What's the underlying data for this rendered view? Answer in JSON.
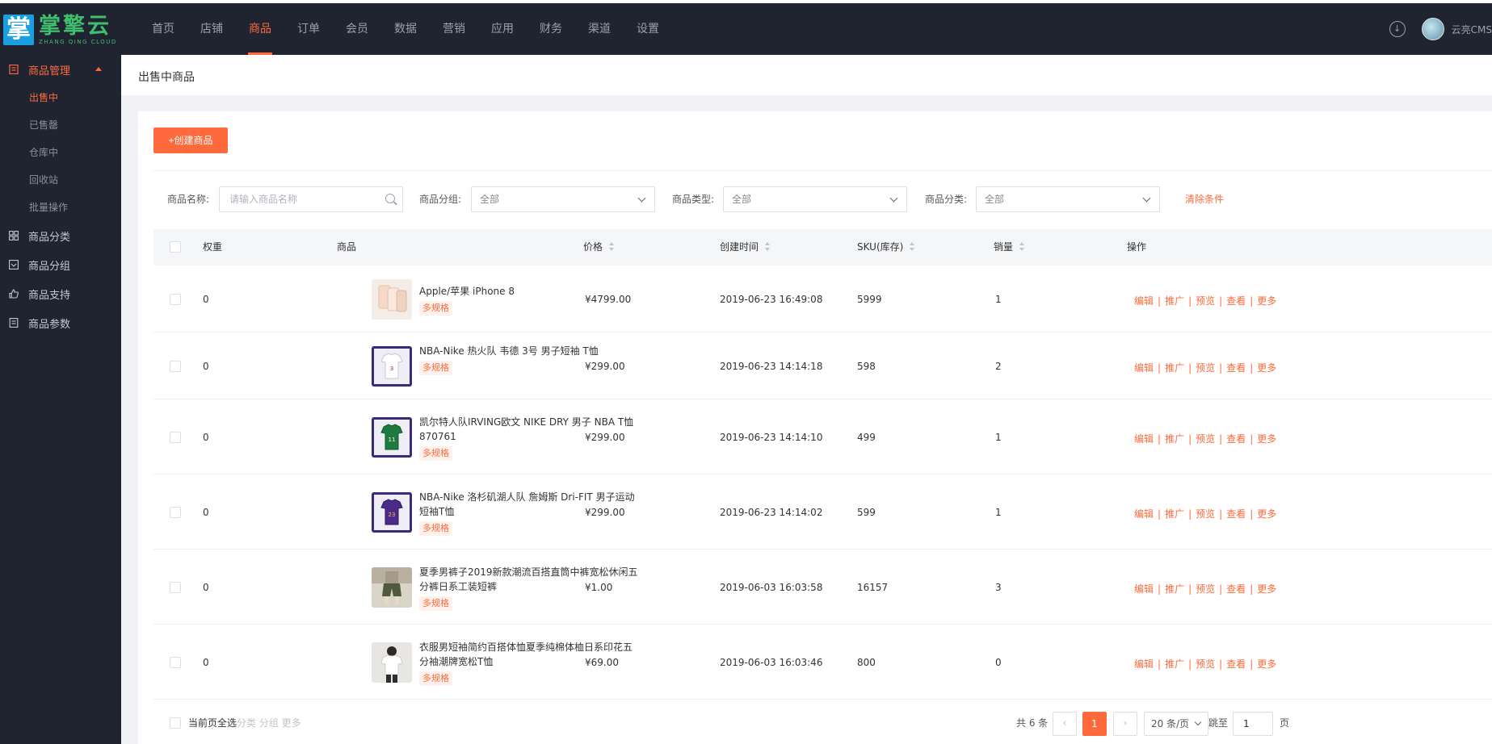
{
  "app": {
    "logo_glyph": "掌",
    "logo_name": "掌擎云",
    "logo_en": "ZHANG QING CLOUD",
    "user_name": "云亮CMS",
    "accent": "#ff6a3c"
  },
  "nav": [
    "首页",
    "店铺",
    "商品",
    "订单",
    "会员",
    "数据",
    "营销",
    "应用",
    "财务",
    "渠道",
    "设置"
  ],
  "sidebar": {
    "group_main": "商品管理",
    "sub_items": [
      "出售中",
      "已售罄",
      "仓库中",
      "回收站",
      "批量操作"
    ],
    "groups": [
      "商品分类",
      "商品分组",
      "商品支持",
      "商品参数"
    ]
  },
  "page": {
    "title": "出售中商品",
    "create_label": "+创建商品"
  },
  "filters": {
    "name_label": "商品名称:",
    "name_placeholder": "请输入商品名称",
    "group_label": "商品分组:",
    "group_value": "全部",
    "type_label": "商品类型:",
    "type_value": "全部",
    "category_label": "商品分类:",
    "category_value": "全部",
    "clear_label": "清除条件"
  },
  "table": {
    "headers": {
      "weight": "权重",
      "product": "商品",
      "price": "价格",
      "created": "创建时间",
      "sku": "SKU(库存)",
      "sales": "销量",
      "actions": "操作"
    },
    "tag_label": "多规格",
    "ops": [
      "编辑",
      "推广",
      "预览",
      "查看",
      "更多"
    ],
    "rows": [
      {
        "weight": "0",
        "name": "Apple/苹果 iPhone 8",
        "price": "¥4799.00",
        "created": "2019-06-23 16:49:08",
        "sku": "5999",
        "sales": "1",
        "thumb": "phone"
      },
      {
        "weight": "0",
        "name": "NBA-Nike 热火队 韦德 3号 男子短袖 T恤",
        "price": "¥299.00",
        "created": "2019-06-23 14:14:18",
        "sku": "598",
        "sales": "2",
        "thumb": "shirt-white"
      },
      {
        "weight": "0",
        "name": "凯尔特人队IRVING欧文 NIKE DRY 男子 NBA T恤 870761",
        "price": "¥299.00",
        "created": "2019-06-23 14:14:10",
        "sku": "499",
        "sales": "1",
        "thumb": "shirt-green"
      },
      {
        "weight": "0",
        "name": "NBA-Nike 洛杉矶湖人队 詹姆斯 Dri-FIT 男子运动 短袖T恤",
        "price": "¥299.00",
        "created": "2019-06-23 14:14:02",
        "sku": "599",
        "sales": "1",
        "thumb": "shirt-purple"
      },
      {
        "weight": "0",
        "name": "夏季男裤子2019新款潮流百搭直筒中裤宽松休闲五分裤日系工装短裤",
        "price": "¥1.00",
        "created": "2019-06-03 16:03:58",
        "sku": "16157",
        "sales": "3",
        "thumb": "shorts"
      },
      {
        "weight": "0",
        "name": "衣服男短袖简约百搭体恤夏季纯棉体桖日系印花五分袖潮牌宽松T恤",
        "price": "¥69.00",
        "created": "2019-06-03 16:03:46",
        "sku": "800",
        "sales": "0",
        "thumb": "tee"
      }
    ]
  },
  "footer": {
    "select_all": "当前页全选",
    "bulk_actions": "分类  分组  更多",
    "total": "共 6 条",
    "prev": "‹",
    "current_page": "1",
    "next": "›",
    "page_size": "20 条/页",
    "jump_label": "跳至",
    "jump_value": "1",
    "page_unit": "页"
  }
}
